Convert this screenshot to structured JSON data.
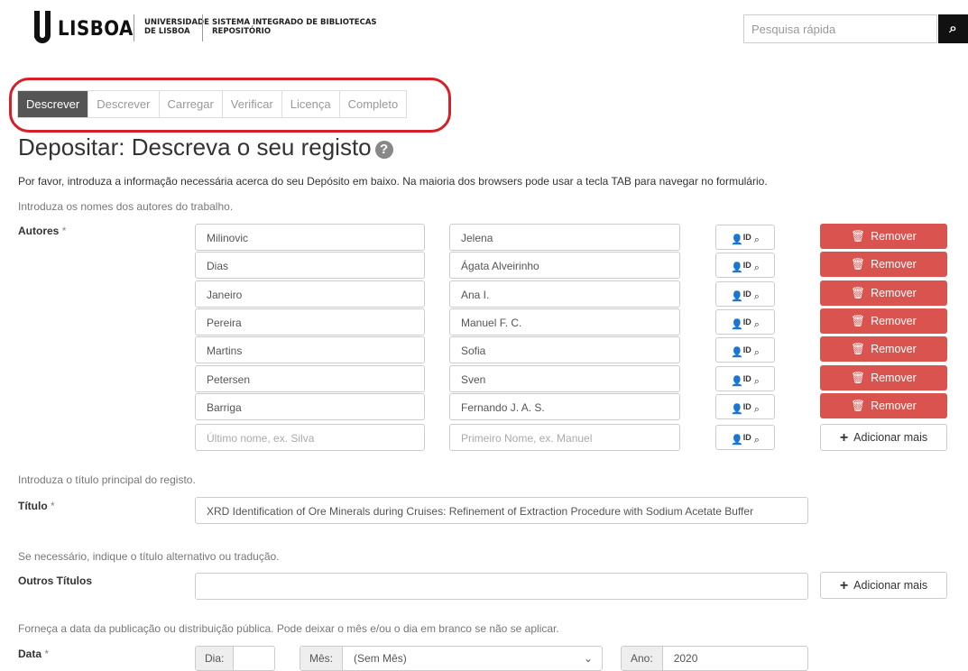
{
  "header": {
    "logo_text": "LISBOA",
    "university_line1": "UNIVERSIDADE",
    "university_line2": "DE LISBOA",
    "system_line1": "SISTEMA INTEGRADO DE BIBLIOTECAS",
    "system_line2": "REPOSITÓRIO",
    "search_placeholder": "Pesquisa rápida",
    "search_icon": "search-icon"
  },
  "tabs": [
    "Descrever",
    "Descrever",
    "Carregar",
    "Verificar",
    "Licença",
    "Completo"
  ],
  "page_title": "Depositar: Descreva o seu registo",
  "intro": "Por favor, introduza a informação necessária acerca do seu Depósito em baixo. Na maioria dos browsers pode usar a tecla TAB para navegar no formulário.",
  "authors_hint": "Introduza os nomes dos autores do trabalho.",
  "authors_label": "Autores",
  "required_mark": "*",
  "authors": [
    {
      "last": "Milinovic",
      "first": "Jelena"
    },
    {
      "last": "Dias",
      "first": "Ágata Alveirinho"
    },
    {
      "last": "Janeiro",
      "first": "Ana I."
    },
    {
      "last": "Pereira",
      "first": "Manuel F. C."
    },
    {
      "last": "Martins",
      "first": "Sofia"
    },
    {
      "last": "Petersen",
      "first": "Sven"
    },
    {
      "last": "Barriga",
      "first": "Fernando J. A. S."
    }
  ],
  "author_placeholders": {
    "last": "Último nome, ex. Silva",
    "first": "Primeiro Nome,  ex. Manuel"
  },
  "lookup_label": "ID",
  "remove_label": "Remover",
  "add_more_label": "Adicionar mais",
  "title_hint": "Introduza o título principal do registo.",
  "title_label": "Título",
  "title_value": "XRD Identification of Ore Minerals during Cruises: Refinement of Extraction Procedure with Sodium Acetate Buffer",
  "alt_title_hint": "Se necessário, indique o título alternativo ou tradução.",
  "alt_title_label": "Outros Títulos",
  "date_hint": "Forneça a data da publicação ou distribuição pública. Pode deixar o mês e/ou o dia em branco se não se aplicar.",
  "date_label": "Data",
  "date": {
    "day_label": "Dia:",
    "day_value": "",
    "month_label": "Mês:",
    "month_value": "(Sem Mês)",
    "year_label": "Ano:",
    "year_value": "2020"
  }
}
